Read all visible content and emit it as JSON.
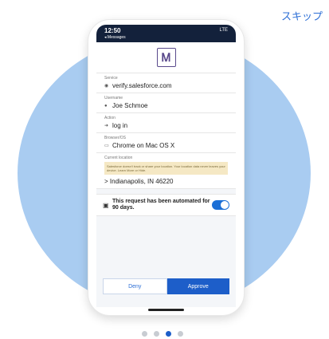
{
  "skip_label": "スキップ",
  "phone": {
    "status": {
      "time": "12:50",
      "back": "◂ Messages",
      "right": "LTE"
    },
    "logo_glyph": "Ꮇ",
    "fields": [
      {
        "label": "Service",
        "value": "verify.salesforce.com",
        "icon": "globe-icon"
      },
      {
        "label": "Username",
        "value": "Joe Schmoe",
        "icon": "person-icon"
      },
      {
        "label": "Action",
        "value": "log in",
        "icon": "arrow-icon"
      },
      {
        "label": "Browser/OS",
        "value": "Chrome on Mac OS X",
        "icon": "monitor-icon"
      }
    ],
    "location": {
      "label": "Current location",
      "warning": "Salesforce doesn't track or share your location. Your location data never leaves your device. Learn More or Hide.",
      "value": "> Indianapolis, IN 46220"
    },
    "automated": {
      "text": "This request has been automated for 90 days.",
      "toggle_on": true
    },
    "deny_label": "Deny",
    "approve_label": "Approve"
  },
  "pagination": {
    "total": 4,
    "active_index": 2
  },
  "colors": {
    "accent": "#1d5ec9",
    "circle": "#a9ccf1",
    "skip": "#2d6fd6"
  }
}
